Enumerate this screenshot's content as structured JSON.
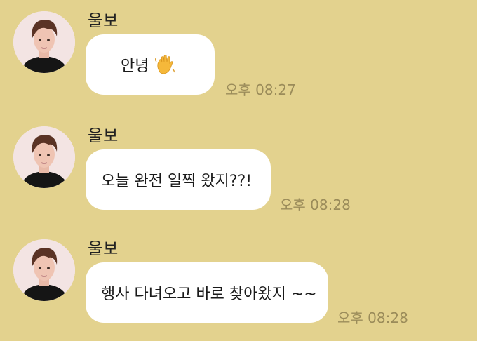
{
  "chat": {
    "messages": [
      {
        "sender": "울보",
        "text": "안녕",
        "icon": "waving-hand-icon",
        "time": "오후 08:27"
      },
      {
        "sender": "울보",
        "text": "오늘 완전 일찍 왔지??!",
        "time": "오후 08:28"
      },
      {
        "sender": "울보",
        "text": "행사 다녀오고 바로 찾아왔지 ~~",
        "time": "오후 08:28"
      }
    ]
  },
  "colors": {
    "background": "#E3D28E",
    "bubble": "#FFFFFF",
    "timestamp": "#9B8C5A"
  }
}
